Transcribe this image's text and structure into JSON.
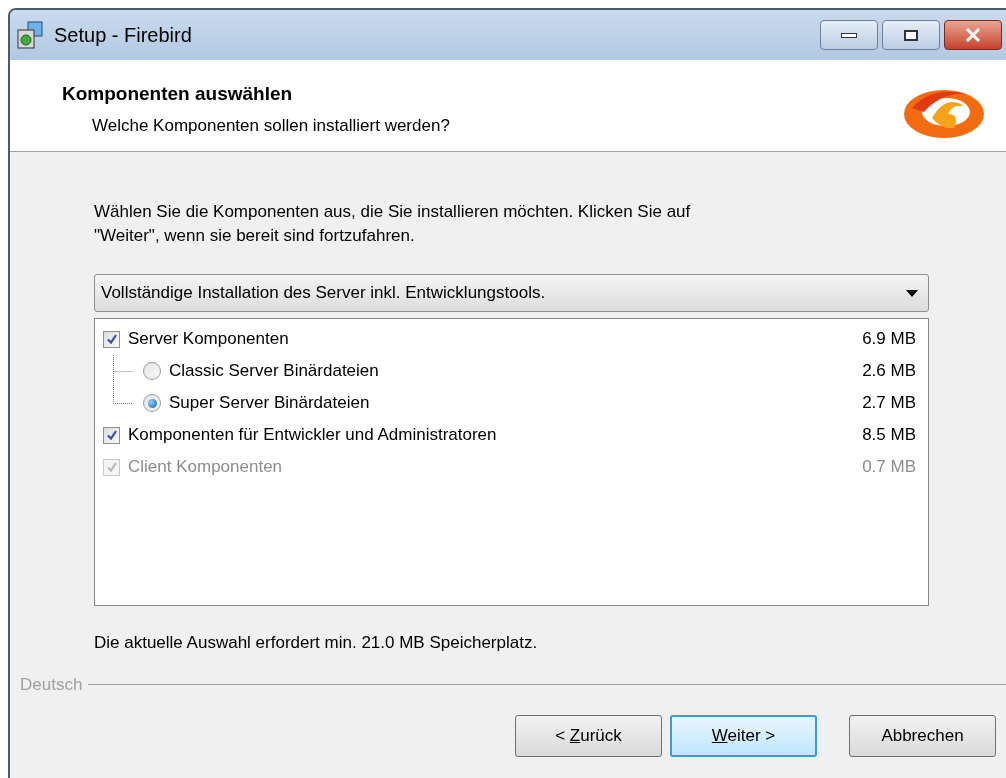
{
  "window": {
    "title": "Setup - Firebird"
  },
  "header": {
    "title": "Komponenten auswählen",
    "subtitle": "Welche Komponenten sollen installiert werden?"
  },
  "intro": "Wählen Sie die Komponenten aus, die Sie installieren möchten. Klicken Sie auf \"Weiter\", wenn sie bereit sind fortzufahren.",
  "install_type": {
    "value": "Vollständige Installation des Server inkl. Entwicklungstools."
  },
  "components": [
    {
      "kind": "checkbox",
      "label": "Server Komponenten",
      "size": "6.9 MB",
      "checked": true,
      "disabled": false,
      "children": [
        {
          "kind": "radio",
          "label": "Classic Server Binärdateien",
          "size": "2.6 MB",
          "selected": false
        },
        {
          "kind": "radio",
          "label": "Super Server Binärdateien",
          "size": "2.7 MB",
          "selected": true
        }
      ]
    },
    {
      "kind": "checkbox",
      "label": "Komponenten für Entwickler und Administratoren",
      "size": "8.5 MB",
      "checked": true,
      "disabled": false
    },
    {
      "kind": "checkbox",
      "label": "Client Komponenten",
      "size": "0.7 MB",
      "checked": true,
      "disabled": true
    }
  ],
  "space_note": "Die aktuelle Auswahl erfordert min. 21.0 MB Speicherplatz.",
  "language": "Deutsch",
  "buttons": [
    {
      "before": "< ",
      "key": "Z",
      "after": "urück",
      "default": false
    },
    {
      "key": "W",
      "after": "eiter >",
      "default": true
    },
    {
      "before": "Abbrechen",
      "default": false
    }
  ]
}
